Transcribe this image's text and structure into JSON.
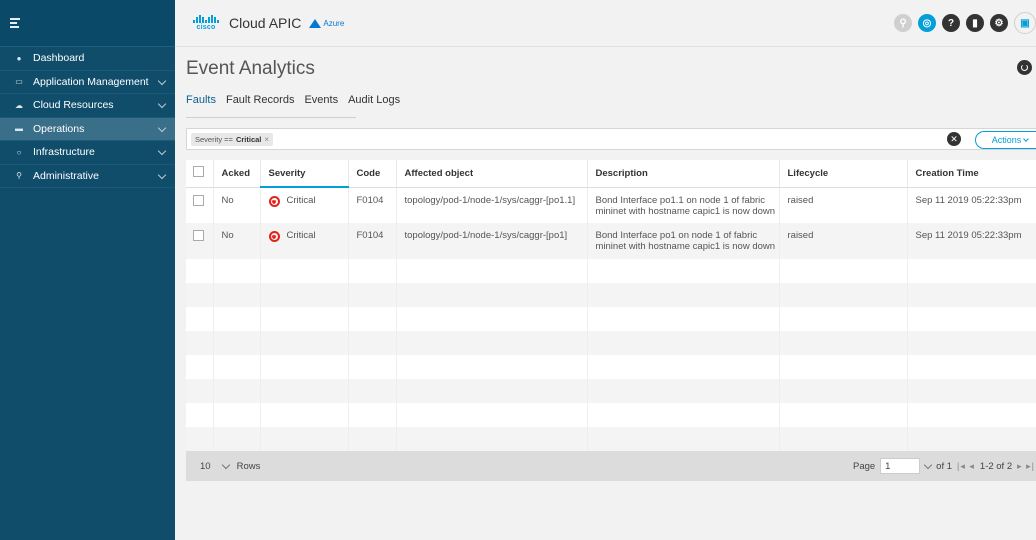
{
  "sidebar": {
    "items": [
      {
        "label": "Dashboard",
        "icon": "dashboard-icon",
        "glyph": "●",
        "chevron": false,
        "active": false
      },
      {
        "label": "Application Management",
        "icon": "app-management-icon",
        "glyph": "▭",
        "chevron": true,
        "active": false
      },
      {
        "label": "Cloud Resources",
        "icon": "cloud-icon",
        "glyph": "☁",
        "chevron": true,
        "active": false
      },
      {
        "label": "Operations",
        "icon": "operations-icon",
        "glyph": "▬",
        "chevron": true,
        "active": true
      },
      {
        "label": "Infrastructure",
        "icon": "infrastructure-icon",
        "glyph": "○",
        "chevron": true,
        "active": false
      },
      {
        "label": "Administrative",
        "icon": "admin-icon",
        "glyph": "⚲",
        "chevron": true,
        "active": false
      }
    ]
  },
  "header": {
    "logo_text": "cisco",
    "app_title": "Cloud APIC",
    "cloud_badge": "Azure",
    "icons": [
      "search-icon",
      "cloud-status-icon",
      "help-icon",
      "bookmark-icon",
      "settings-icon",
      "user-icon"
    ]
  },
  "page": {
    "title": "Event Analytics",
    "tabs": [
      {
        "label": "Faults",
        "active": true
      },
      {
        "label": "Fault Records",
        "active": false
      },
      {
        "label": "Events",
        "active": false
      },
      {
        "label": "Audit Logs",
        "active": false
      }
    ]
  },
  "filter": {
    "chip_key": "Severity == ",
    "chip_value": "Critical",
    "chip_close": "×",
    "actions_label": "Actions"
  },
  "table": {
    "columns": [
      "Acked",
      "Severity",
      "Code",
      "Affected object",
      "Description",
      "Lifecycle",
      "Creation Time"
    ],
    "rows": [
      {
        "acked": "No",
        "severity": "Critical",
        "code": "F0104",
        "affected_object": "topology/pod-1/node-1/sys/caggr-[po1.1]",
        "description": "Bond Interface po1.1 on node 1 of fabric mininet with hostname capic1 is now down",
        "lifecycle": "raised",
        "creation_time": "Sep 11 2019 05:22:33pm"
      },
      {
        "acked": "No",
        "severity": "Critical",
        "code": "F0104",
        "affected_object": "topology/pod-1/node-1/sys/caggr-[po1]",
        "description": "Bond Interface po1 on node 1 of fabric mininet with hostname capic1 is now down",
        "lifecycle": "raised",
        "creation_time": "Sep 11 2019 05:22:33pm"
      }
    ]
  },
  "pagination": {
    "rows_per_page": "10",
    "rows_label": "Rows",
    "page_label": "Page",
    "current_page": "1",
    "of_pages": "of 1",
    "nav_prev": "|◂ ◂",
    "range": "1-2 of 2",
    "nav_next": "▸ ▸|"
  },
  "colors": {
    "sidebar_bg": "#0f4d6b",
    "accent": "#049fd9",
    "critical": "#e2231a"
  }
}
